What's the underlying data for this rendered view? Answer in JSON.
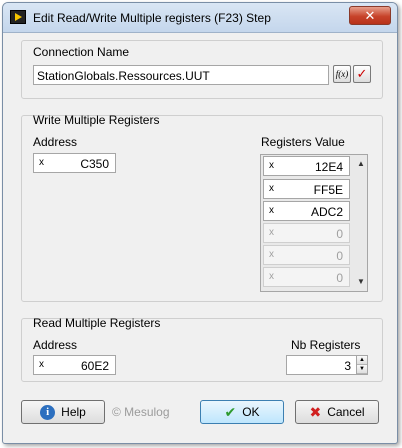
{
  "window": {
    "title": "Edit Read/Write Multiple registers (F23) Step",
    "close_glyph": "✕"
  },
  "connection": {
    "group_label": "Connection Name",
    "value": "StationGlobals.Ressources.UUT",
    "expr_icon": "f(x)",
    "check_icon": "✓"
  },
  "write": {
    "group_label": "Write Multiple Registers",
    "address_label": "Address",
    "address": {
      "prefix": "x",
      "value": "C350"
    },
    "registers_label": "Registers Value",
    "registers": [
      {
        "prefix": "x",
        "value": "12E4",
        "enabled": true
      },
      {
        "prefix": "x",
        "value": "FF5E",
        "enabled": true
      },
      {
        "prefix": "x",
        "value": "ADC2",
        "enabled": true
      },
      {
        "prefix": "x",
        "value": "0",
        "enabled": false
      },
      {
        "prefix": "x",
        "value": "0",
        "enabled": false
      },
      {
        "prefix": "x",
        "value": "0",
        "enabled": false
      }
    ],
    "scroll_up": "▲",
    "scroll_down": "▼"
  },
  "read": {
    "group_label": "Read Multiple Registers",
    "address_label": "Address",
    "address": {
      "prefix": "x",
      "value": "60E2"
    },
    "nb_label": "Nb Registers",
    "nb_value": "3",
    "spin_up": "▲",
    "spin_down": "▼"
  },
  "footer": {
    "help_label": "Help",
    "help_icon": "i",
    "copyright": "© Mesulog",
    "ok_label": "OK",
    "ok_icon": "✔",
    "cancel_label": "Cancel",
    "cancel_icon": "✖"
  },
  "colors": {
    "help_icon_bg": "#2c6fbf",
    "ok_icon": "#2e9a2e",
    "cancel_icon": "#d12020",
    "check_icon": "#cc0000"
  }
}
